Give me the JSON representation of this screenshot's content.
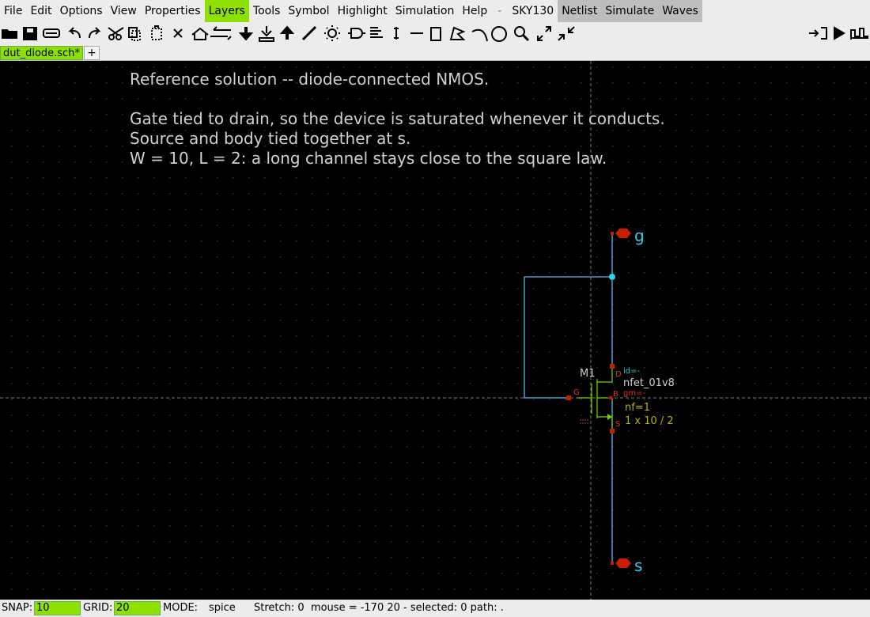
{
  "menubar": {
    "items": [
      {
        "label": "File",
        "style": ""
      },
      {
        "label": "Edit",
        "style": ""
      },
      {
        "label": "Options",
        "style": ""
      },
      {
        "label": "View",
        "style": ""
      },
      {
        "label": "Properties",
        "style": ""
      },
      {
        "label": "Layers",
        "style": "green"
      },
      {
        "label": "Tools",
        "style": ""
      },
      {
        "label": "Symbol",
        "style": ""
      },
      {
        "label": "Highlight",
        "style": ""
      },
      {
        "label": "Simulation",
        "style": ""
      },
      {
        "label": "Help",
        "style": ""
      },
      {
        "label": "-",
        "style": "dash"
      },
      {
        "label": "SKY130",
        "style": ""
      },
      {
        "label": "Netlist",
        "style": "grey"
      },
      {
        "label": "Simulate",
        "style": "grey"
      },
      {
        "label": "Waves",
        "style": "grey"
      }
    ]
  },
  "tabs": {
    "file": "dut_diode.sch*",
    "add": "+"
  },
  "canvas": {
    "notes": [
      "Reference solution -- diode-connected NMOS.",
      "Gate tied to drain, so the device is saturated whenever it conducts.",
      "Source and body tied together at s.",
      "W = 10, L = 2: a long channel stays close to the square law."
    ],
    "pin_g": "g",
    "pin_s": "s",
    "instance": "M1",
    "model": "nfet_01v8",
    "id_label": "id=-",
    "gm_label": "gm=-",
    "nf_label": "nf=1",
    "size_label": "1 x 10 / 2",
    "term_d": "D",
    "term_g": "G",
    "term_b": "B",
    "term_s": "S",
    "colors": {
      "wire": "#4fb9e8",
      "pin": "#c81e00",
      "text": "#d0d0d0",
      "green": "#7dd000",
      "yellow": "#b4b400",
      "cyan": "#33d1c8",
      "red": "#e03030"
    }
  },
  "status": {
    "snap_label": "SNAP:",
    "snap_value": "10",
    "grid_label": "GRID:",
    "grid_value": "20",
    "mode_label": "MODE:",
    "mode_value": "spice",
    "info": "Stretch: 0  mouse = -170 20 - selected: 0 path: ."
  }
}
